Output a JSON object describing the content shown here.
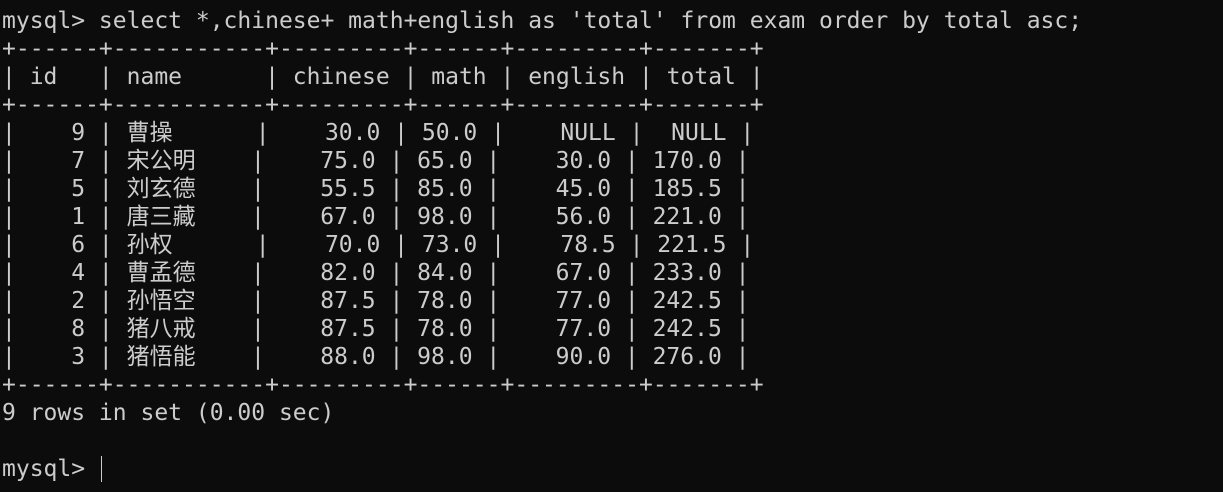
{
  "terminal": {
    "command_line": "mysql> select *,chinese+ math+english as 'total' from exam order by total asc;",
    "border_top": "+------+-----------+---------+------+---------+-------+",
    "header_row": "| id   | name      | chinese | math | english | total |",
    "border_mid": "+------+-----------+---------+------+---------+-------+",
    "rows": [
      "|    9 | 曹操      |    30.0 | 50.0 |    NULL |  NULL |",
      "|    7 | 宋公明    |    75.0 | 65.0 |    30.0 | 170.0 |",
      "|    5 | 刘玄德    |    55.5 | 85.0 |    45.0 | 185.5 |",
      "|    1 | 唐三藏    |    67.0 | 98.0 |    56.0 | 221.0 |",
      "|    6 | 孙权      |    70.0 | 73.0 |    78.5 | 221.5 |",
      "|    4 | 曹孟德    |    82.0 | 84.0 |    67.0 | 233.0 |",
      "|    2 | 孙悟空    |    87.5 | 78.0 |    77.0 | 242.5 |",
      "|    8 | 猪八戒    |    87.5 | 78.0 |    77.0 | 242.5 |",
      "|    3 | 猪悟能    |    88.0 | 98.0 |    90.0 | 276.0 |"
    ],
    "border_bottom": "+------+-----------+---------+------+---------+-------+",
    "result_summary": "9 rows in set (0.00 sec)",
    "prompt": "mysql> "
  }
}
